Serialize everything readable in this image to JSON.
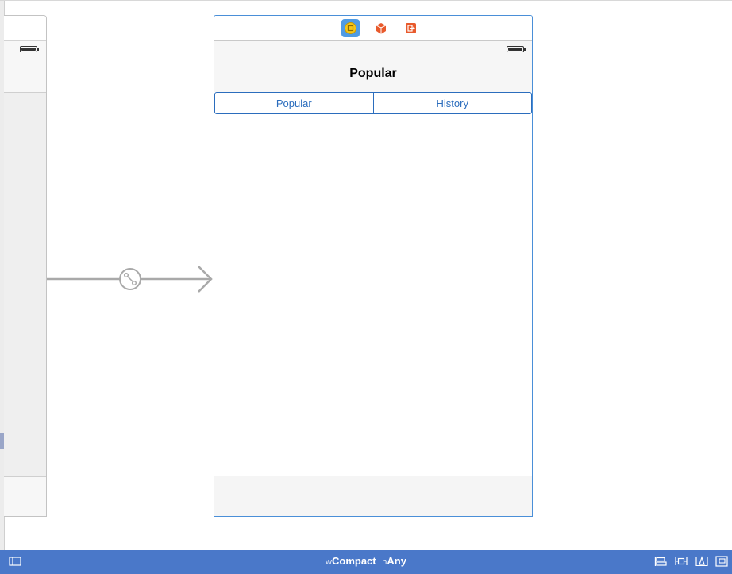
{
  "scene": {
    "title": "Popular",
    "segments": [
      "Popular",
      "History"
    ],
    "dock_icons": [
      "view-controller-icon",
      "first-responder-icon",
      "exit-icon"
    ]
  },
  "bottom_bar": {
    "width_prefix": "w",
    "width_value": "Compact",
    "height_prefix": "h",
    "height_value": "Any",
    "icons": [
      "navigator-toggle-icon",
      "align-icon",
      "pin-icon",
      "resolve-issues-icon",
      "resizing-icon"
    ]
  },
  "colors": {
    "accent": "#2b6dbd",
    "selection": "#4f9be4",
    "bottom_bar": "#4a78c9",
    "dock_orange": "#e85a2c"
  }
}
